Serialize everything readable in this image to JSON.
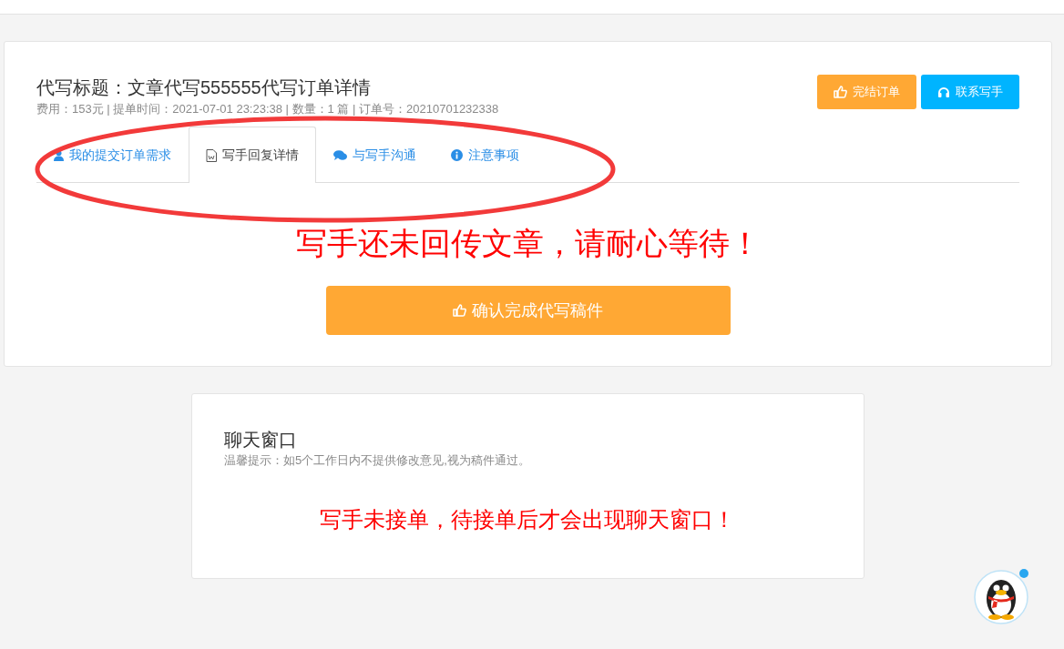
{
  "order": {
    "title": "代写标题：文章代写555555代写订单详情",
    "meta": "费用：153元 | 提单时间：2021-07-01 23:23:38 | 数量：1 篇 | 订单号：20210701232338",
    "actions": [
      {
        "kind": "finish",
        "label": "完结订单"
      },
      {
        "kind": "contact",
        "label": "联系写手"
      }
    ],
    "tabs": [
      {
        "label": "我的提交订单需求",
        "selected": false
      },
      {
        "label": "写手回复详情",
        "selected": true
      },
      {
        "label": "与写手沟通",
        "selected": false
      },
      {
        "label": "注意事项",
        "selected": false
      }
    ],
    "notice": "写手还未回传文章，请耐心等待！",
    "confirm_button": "确认完成代写稿件"
  },
  "chat": {
    "title": "聊天窗口",
    "hint": "温馨提示：如5个工作日内不提供修改意见,视为稿件通过。",
    "message": "写手未接单，待接单后才会出现聊天窗口！"
  }
}
